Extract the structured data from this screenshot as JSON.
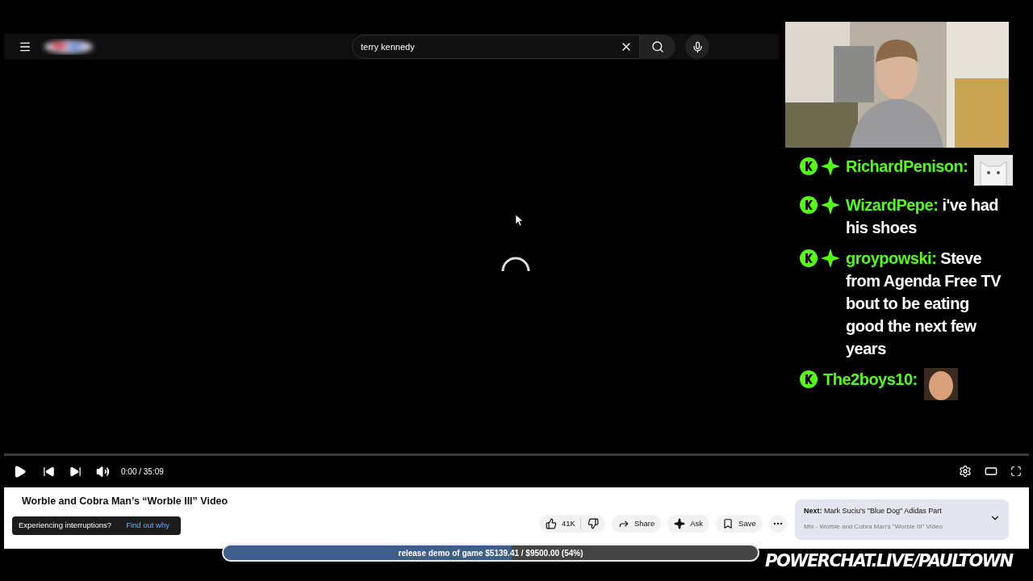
{
  "search": {
    "value": "terry kennedy"
  },
  "chat": [
    {
      "user": "RichardPenison:",
      "sparkle_badge": true,
      "emote": true
    },
    {
      "user": "WizardPepe:",
      "sparkle_badge": true,
      "text": "i've had his shoes",
      "emote": false
    },
    {
      "user": "groypowski:",
      "sparkle_badge": true,
      "text": "Steve from Agenda Free TV bout to be eating good the next few years",
      "emote": false
    },
    {
      "user": "The2boys10:",
      "sparkle_badge": false,
      "emote": true
    }
  ],
  "player": {
    "time": "0:00 / 35:09",
    "playing": false
  },
  "video": {
    "title": "Worble and Cobra Man’s “Worble III” Video",
    "likes": "41K",
    "actions": [
      "Share",
      "Ask",
      "Save"
    ]
  },
  "toast": {
    "text": "Experiencing interruptions?",
    "link": "Find out why"
  },
  "next": {
    "label": "Next:",
    "title": "Mark Suciu's \"Blue Dog\" Adidas Part",
    "subtitle": "Mix - Worble and Cobra Man’s “Worble III” Video"
  },
  "goal": {
    "text": "release demo of game $5139.41 / $9500.00 (54%)",
    "level": 0.54
  },
  "overlay": {
    "url": "POWERCHAT.LIVE/PAULTOWN"
  }
}
